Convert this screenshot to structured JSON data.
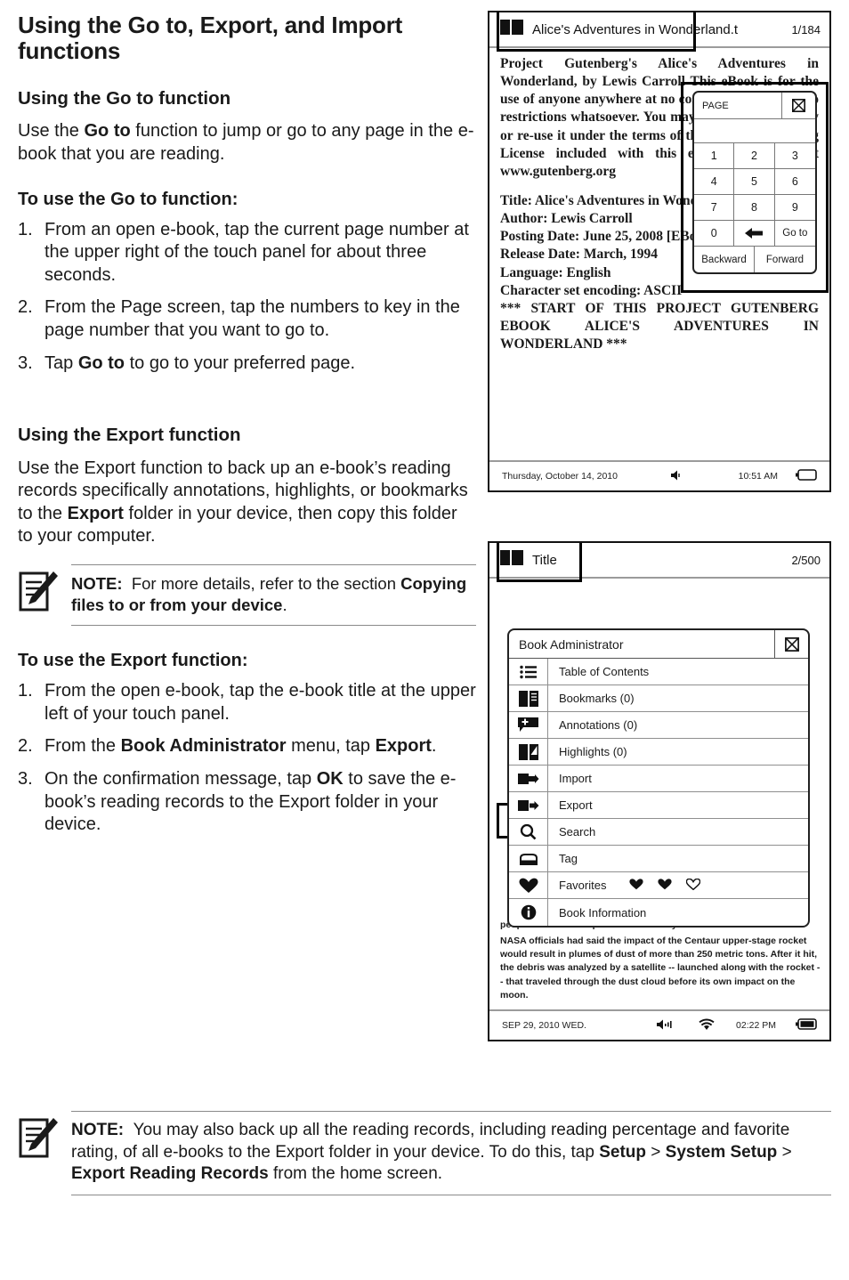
{
  "document": {
    "title": "Using the Go to, Export, and Import functions"
  },
  "goto_section": {
    "heading": "Using the Go to function",
    "intro_prefix": "Use the ",
    "intro_bold": "Go to",
    "intro_suffix": " function to jump or go to any page in the e-book that you are reading.",
    "steps_heading": "To use the Go to function:",
    "steps": [
      {
        "text": "From an open e-book, tap the current page number at the upper right of the touch panel for about three seconds."
      },
      {
        "text": "From the Page screen, tap the numbers to key in the page number that you want to go to."
      },
      {
        "pre": "Tap ",
        "bold": "Go to",
        "post": " to go to your preferred page."
      }
    ]
  },
  "export_section": {
    "heading": "Using the Export function",
    "intro_pre": "Use the Export function to back up an e-book’s reading records specifically annotations, highlights, or bookmarks to the ",
    "intro_bold": "Export",
    "intro_post": " folder in your device, then copy this folder to your computer.",
    "note": {
      "label": "NOTE:",
      "pre": "For more details, refer to the section ",
      "bold": "Copying files to or from your device",
      "post": "."
    },
    "steps_heading": "To use the Export function:",
    "steps": [
      {
        "text": "From the open e-book, tap the e-book title at the upper left of your touch panel."
      },
      {
        "pre": "From the ",
        "bold": "Book Administrator",
        "mid": " menu, tap ",
        "bold2": "Export",
        "post": "."
      },
      {
        "pre": "On the confirmation message, tap ",
        "bold": "OK",
        "post": " to save the e-book’s reading records to the Export folder in your device."
      }
    ]
  },
  "bottom_note": {
    "label": "NOTE:",
    "pre": "You may also back up all the reading records, including reading percentage and favorite rating, of all e-books to the Export folder in your device. To do this, tap ",
    "b1": "Setup",
    "sep1": " > ",
    "b2": "System Setup",
    "sep2": " > ",
    "b3": "Export Reading Records",
    "post": " from the home screen."
  },
  "device_goto": {
    "header": {
      "icon": "book-glyph-icon",
      "title": "Alice's Adventures in Wonderland.t",
      "page_indicator": "1/184"
    },
    "body": {
      "paragraph": "Project Gutenberg's Alice's Adventures in Wonderland, by Lewis Carroll This eBook is for the use of anyone anywhere at no cost and with almost no restrictions whatsoever. You may copy it, give it away or re-use it under the terms of the Project Gutenberg License included with this eBook or online at www.gutenberg.org",
      "meta_lines": [
        "Title: Alice's Adventures in Wonderland",
        "Author: Lewis Carroll",
        "Posting Date: June 25, 2008 [EBook #11]",
        "Release Date: March, 1994",
        "Language: English",
        "Character set encoding: ASCII"
      ],
      "start_marker": "*** START OF THIS PROJECT GUTENBERG EBOOK ALICE'S ADVENTURES IN WONDERLAND ***"
    },
    "status": {
      "date": "Thursday, October 14, 2010",
      "speaker_icon": "speaker-icon",
      "time": "10:51 AM",
      "battery_icon": "battery-icon"
    },
    "keypad": {
      "label": "PAGE",
      "close_icon": "close-x-box-icon",
      "display_value": "",
      "keys": [
        "1",
        "2",
        "3",
        "4",
        "5",
        "6",
        "7",
        "8",
        "9",
        "0"
      ],
      "backspace_icon": "backspace-arrow-icon",
      "goto_label": "Go to",
      "backward_label": "Backward",
      "forward_label": "Forward"
    }
  },
  "device_export": {
    "header": {
      "icon": "book-glyph-icon",
      "title": "Title",
      "page_indicator": "2/500"
    },
    "panel": {
      "title": "Book Administrator",
      "close_icon": "close-x-box-icon",
      "rows": [
        {
          "icon": "list-icon",
          "label": "Table of Contents"
        },
        {
          "icon": "bookmark-icon",
          "label": "Bookmarks (0)"
        },
        {
          "icon": "annotation-flag-icon",
          "label": "Annotations (0)"
        },
        {
          "icon": "highlight-pen-icon",
          "label": "Highlights (0)"
        },
        {
          "icon": "import-arrow-icon",
          "label": "Import"
        },
        {
          "icon": "export-arrow-icon",
          "label": "Export"
        },
        {
          "icon": "magnifier-icon",
          "label": "Search"
        },
        {
          "icon": "tag-icon",
          "label": "Tag"
        },
        {
          "icon": "heart-icon",
          "label": "Favorites"
        },
        {
          "icon": "info-circle-icon",
          "label": "Book Information"
        }
      ],
      "favorites_hearts": [
        "heart-filled-icon",
        "heart-filled-icon",
        "heart-outline-icon"
      ]
    },
    "page_text": {
      "ghost_line": "people could find \"a public event near you.\"",
      "paragraph": "NASA officials had said the impact of the Centaur upper-stage rocket would result in plumes of dust of more than 250 metric tons. After it hit, the debris was analyzed by a satellite -- launched along with the rocket -- that traveled through the dust cloud before its own impact on the moon."
    },
    "status": {
      "date": "SEP 29, 2010  WED.",
      "speaker_icon": "speaker-icon",
      "wifi_icon": "wifi-icon",
      "time": "02:22 PM",
      "battery_icon": "battery-icon"
    }
  },
  "colors": {
    "ink": "#1a1a1a",
    "rule": "#8a8a8a",
    "frame": "#111111"
  }
}
